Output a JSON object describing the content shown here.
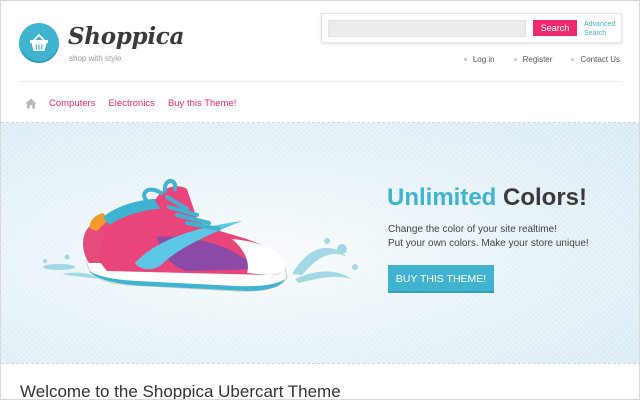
{
  "header": {
    "logo_name": "Shoppica",
    "logo_tagline": "shop with style",
    "search": {
      "placeholder": "",
      "button_label": "Search",
      "advanced_line1": "Advanced",
      "advanced_line2": "Search"
    },
    "top_links": [
      "Log in",
      "Register",
      "Contact Us"
    ]
  },
  "nav": {
    "home_icon": "home-icon",
    "items": [
      "Computers",
      "Electronics",
      "Buy this Theme!"
    ]
  },
  "banner": {
    "headline_blue": "Unlimited",
    "headline_dark": "Colors!",
    "line1": "Change the color of your site realtime!",
    "line2": "Put your own colors.  Make your store unique!",
    "button_label": "BUY THIS THEME!",
    "image": "sneaker-image"
  },
  "main": {
    "welcome_title": "Welcome to the Shoppica Ubercart Theme"
  },
  "colors": {
    "accent_blue": "#3fb3cf",
    "accent_pink": "#ec2a6d",
    "banner_bg": "#e4f1f7"
  }
}
